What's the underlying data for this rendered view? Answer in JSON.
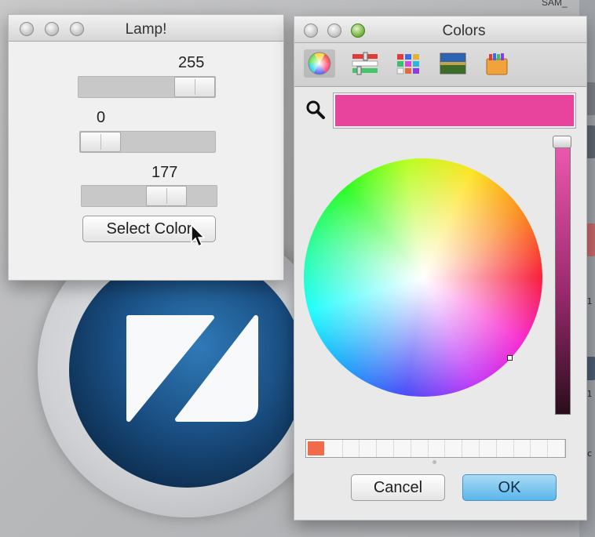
{
  "desktop": {
    "top_right_fragment": "SAM_",
    "right_strip_labels": [
      "_1",
      "_1",
      "_c"
    ]
  },
  "lamp_window": {
    "title": "Lamp!",
    "sliders": [
      {
        "value_label": "255",
        "value": 255,
        "max": 255
      },
      {
        "value_label": "0",
        "value": 0,
        "max": 255
      },
      {
        "value_label": "177",
        "value": 177,
        "max": 255
      }
    ],
    "select_color_label": "Select Color"
  },
  "colors_window": {
    "title": "Colors",
    "toolbar_icons": [
      "color-wheel-icon",
      "color-sliders-icon",
      "color-palettes-icon",
      "image-palettes-icon",
      "crayons-icon"
    ],
    "current_color": "#e8449d",
    "cancel_label": "Cancel",
    "ok_label": "OK",
    "palette_first_swatch": "#f26a4a"
  },
  "colors": {
    "accent_ok": "#59b5ea",
    "window_bg": "#ececec"
  }
}
